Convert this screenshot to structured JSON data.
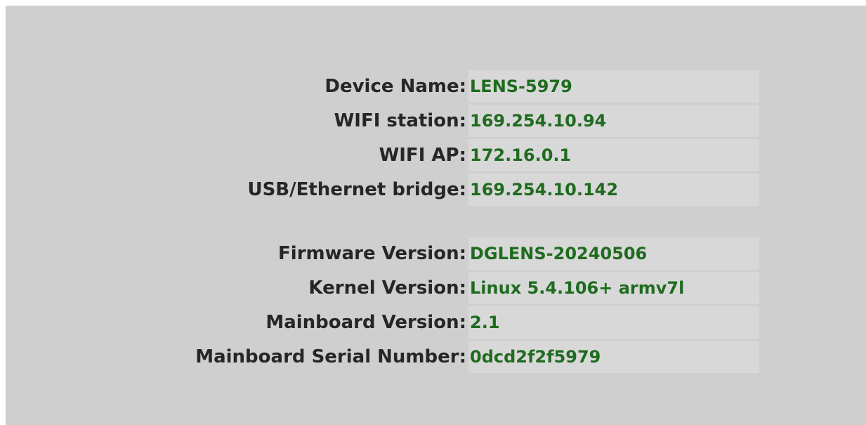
{
  "network": {
    "rows": [
      {
        "label": "Device Name:",
        "value": "LENS-5979"
      },
      {
        "label": "WIFI station:",
        "value": "169.254.10.94"
      },
      {
        "label": "WIFI AP:",
        "value": "172.16.0.1"
      },
      {
        "label": "USB/Ethernet bridge:",
        "value": "169.254.10.142"
      }
    ]
  },
  "system": {
    "rows": [
      {
        "label": "Firmware Version:",
        "value": "DGLENS-20240506"
      },
      {
        "label": "Kernel Version:",
        "value": "Linux 5.4.106+ armv7l"
      },
      {
        "label": "Mainboard Version:",
        "value": "2.1"
      },
      {
        "label": "Mainboard Serial Number:",
        "value": "0dcd2f2f5979"
      }
    ]
  },
  "colors": {
    "panel_background": "#cfcfcf",
    "label_text": "#262626",
    "value_text": "#1f6b1f",
    "value_background": "#d8d8d8"
  }
}
